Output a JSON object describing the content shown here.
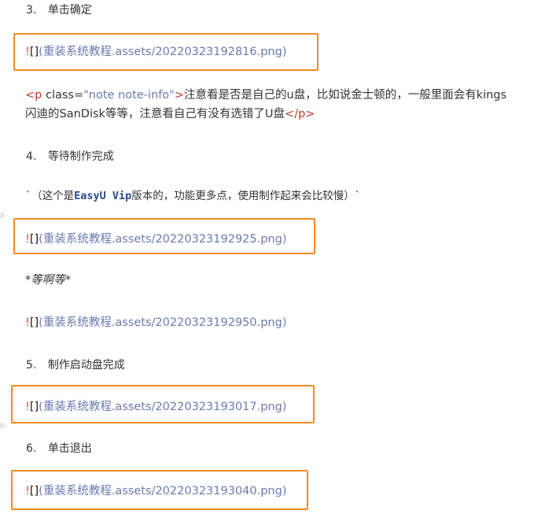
{
  "doc": {
    "step3": {
      "num": "3.",
      "text": "单击确定"
    },
    "img1": {
      "bang": "!",
      "brackets": "[]",
      "path": "(重装系统教程.assets/20220323192816.png)"
    },
    "note": {
      "tag_open": "<p ",
      "attr_name": "class=",
      "attr_value": "\"note note-info\"",
      "tag_close_gt": ">",
      "line1_text": "注意看是否是自己的u盘，比如说金士顿的，一般里面会有kings",
      "line2_text": "闪迪的SanDisk等等，注意看自己有没有选错了U盘",
      "tag_end": "</p>"
    },
    "step4": {
      "num": "4.",
      "text": "等待制作完成"
    },
    "codeline": {
      "tick_open": "`（这个是",
      "kw": "EasyU Vip",
      "rest": "版本的，功能更多点，使用制作起来会比较慢）`"
    },
    "img2": {
      "bang": "!",
      "brackets": "[]",
      "path": "(重装系统教程.assets/20220323192925.png)"
    },
    "wait": "*等啊等*",
    "img3": {
      "bang": "!",
      "brackets": "[]",
      "path": "(重装系统教程.assets/20220323192950.png)"
    },
    "step5": {
      "num": "5.",
      "text": "制作启动盘完成"
    },
    "img4": {
      "bang": "!",
      "brackets": "[]",
      "path": "(重装系统教程.assets/20220323193017.png)"
    },
    "step6": {
      "num": "6.",
      "text": "单击退出"
    },
    "img5": {
      "bang": "!",
      "brackets": "[]",
      "path": "(重装系统教程.assets/20220323193040.png)"
    },
    "margin_marks": [
      "0",
      "0"
    ]
  },
  "colors": {
    "highlight_border": "#f48a26",
    "link_path": "#6b7ab0",
    "bang": "#d9534f"
  }
}
